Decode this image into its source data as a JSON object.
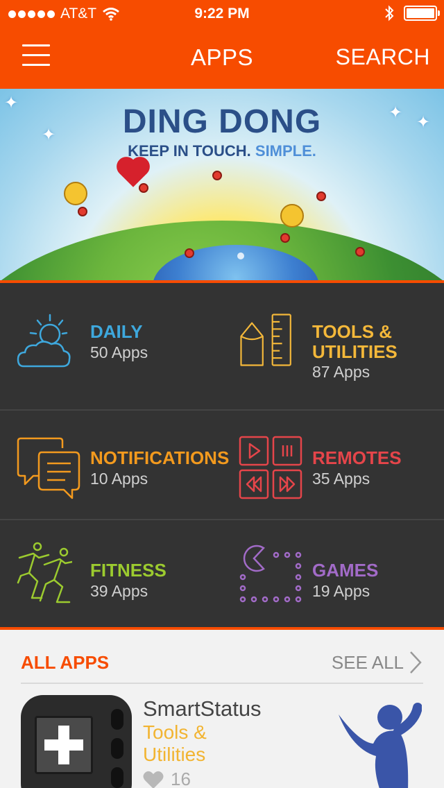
{
  "status_bar": {
    "carrier": "AT&T",
    "time": "9:22 PM"
  },
  "nav": {
    "title": "APPS",
    "search_label": "SEARCH"
  },
  "banner": {
    "headline": "DING DONG",
    "tagline_part1": "KEEP IN TOUCH.",
    "tagline_part2": "SIMPLE."
  },
  "categories": [
    {
      "label": "DAILY",
      "count": "50 Apps",
      "color": "#3ea8dd",
      "icon": "weather-icon"
    },
    {
      "label_line1": "TOOLS &",
      "label_line2": "UTILITIES",
      "count": "87 Apps",
      "color": "#f4b83a",
      "icon": "tools-icon"
    },
    {
      "label": "NOTIFICATIONS",
      "count": "10 Apps",
      "color": "#f39a1e",
      "icon": "chat-bubbles-icon"
    },
    {
      "label": "REMOTES",
      "count": "35 Apps",
      "color": "#e5454a",
      "icon": "remote-icon"
    },
    {
      "label": "FITNESS",
      "count": "39 Apps",
      "color": "#9ccb2f",
      "icon": "runners-icon"
    },
    {
      "label": "GAMES",
      "count": "19 Apps",
      "color": "#a26bc8",
      "icon": "pacman-icon"
    }
  ],
  "all_apps": {
    "title": "ALL APPS",
    "see_all_label": "SEE ALL",
    "apps": [
      {
        "name": "SmartStatus",
        "category_line1": "Tools &",
        "category_line2": "Utilities",
        "likes": "16"
      }
    ]
  },
  "colors": {
    "accent": "#f74c00",
    "grid_bg": "#333333",
    "page_bg": "#f2f2f2"
  }
}
